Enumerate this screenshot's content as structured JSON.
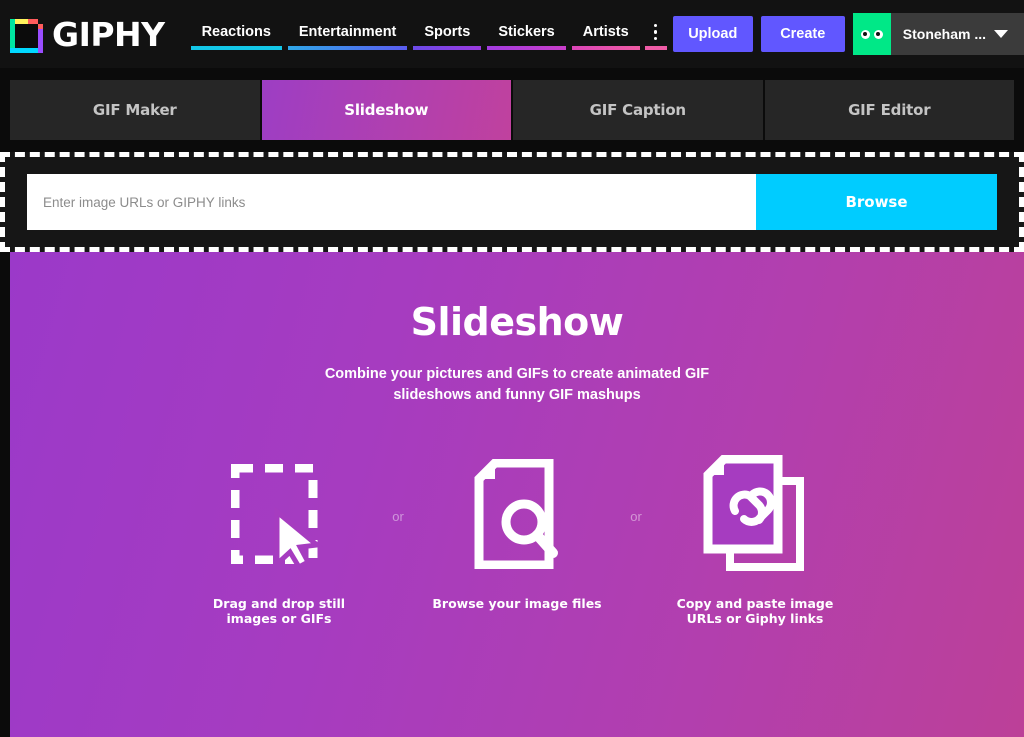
{
  "header": {
    "logo_text": "GIPHY",
    "logo_icon": "giphy-logo-icon",
    "nav": [
      {
        "label": "Reactions",
        "underline": "#13c7e8"
      },
      {
        "label": "Entertainment",
        "underline": "#4a6cf0"
      },
      {
        "label": "Sports",
        "underline": "#8a3fe0"
      },
      {
        "label": "Stickers",
        "underline": "#b43ce0"
      },
      {
        "label": "Artists",
        "underline": "#e155ae"
      },
      {
        "label": "more-menu",
        "underline": "#ee5ba6"
      }
    ],
    "upload_label": "Upload",
    "create_label": "Create",
    "account_name": "Stoneham ...",
    "avatar_icon": "green-eyes-avatar-icon",
    "caret_icon": "chevron-down-icon",
    "button_color": "#6157ff",
    "avatar_color": "#00e887"
  },
  "tabs": [
    {
      "label": "GIF Maker",
      "active": false
    },
    {
      "label": "Slideshow",
      "active": true
    },
    {
      "label": "GIF Caption",
      "active": false
    },
    {
      "label": "GIF Editor",
      "active": false
    }
  ],
  "dropzone": {
    "input_value": "",
    "input_placeholder": "Enter image URLs or GIPHY links",
    "browse_label": "Browse",
    "browse_color": "#00ccff"
  },
  "hero": {
    "title": "Slideshow",
    "subtitle": "Combine your pictures and GIFs to create animated GIF slideshows and funny GIF mashups",
    "separator_label": "or",
    "options": [
      {
        "icon": "drag-drop-cursor-icon",
        "label": "Drag and drop still images or GIFs"
      },
      {
        "icon": "document-search-icon",
        "label": "Browse your image files"
      },
      {
        "icon": "documents-link-icon",
        "label": "Copy and paste image URLs or Giphy links"
      }
    ],
    "gradient_start": "#9b39c9",
    "gradient_end": "#bc4098"
  }
}
